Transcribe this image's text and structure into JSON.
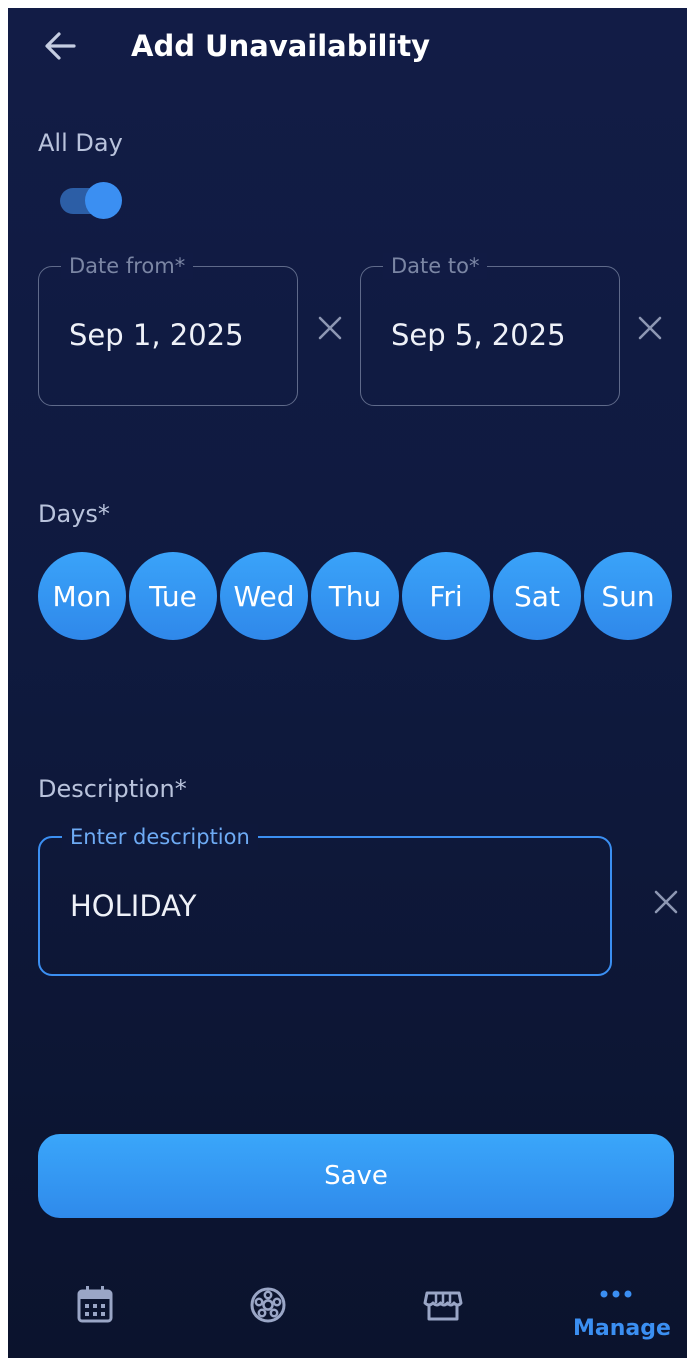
{
  "header": {
    "title": "Add Unavailability",
    "back_icon": "arrow-left-icon"
  },
  "all_day": {
    "label": "All Day",
    "enabled": true
  },
  "date_from": {
    "legend": "Date from*",
    "value": "Sep 1, 2025"
  },
  "date_to": {
    "legend": "Date to*",
    "value": "Sep 5, 2025"
  },
  "days": {
    "label": "Days*",
    "items": [
      {
        "label": "Mon",
        "selected": true
      },
      {
        "label": "Tue",
        "selected": true
      },
      {
        "label": "Wed",
        "selected": true
      },
      {
        "label": "Thu",
        "selected": true
      },
      {
        "label": "Fri",
        "selected": true
      },
      {
        "label": "Sat",
        "selected": true
      },
      {
        "label": "Sun",
        "selected": true
      }
    ]
  },
  "description": {
    "label": "Description*",
    "legend": "Enter description",
    "value": "HOLIDAY"
  },
  "save_label": "Save",
  "bottom_nav": {
    "items": [
      {
        "icon": "calendar-icon"
      },
      {
        "icon": "soccer-ball-icon"
      },
      {
        "icon": "store-icon"
      },
      {
        "icon": "more-dots-icon",
        "label": "Manage",
        "active": true
      }
    ]
  },
  "colors": {
    "accent": "#3b8ff2",
    "background": "#111b44",
    "text_muted": "#b9c3dc"
  }
}
